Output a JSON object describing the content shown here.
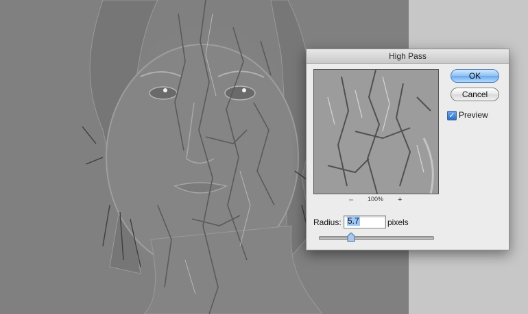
{
  "dialog": {
    "title": "High Pass",
    "ok_label": "OK",
    "cancel_label": "Cancel",
    "preview_label": "Preview",
    "preview_checked": true,
    "zoom_minus": "–",
    "zoom_level": "100%",
    "zoom_plus": "+",
    "radius_label": "Radius:",
    "radius_value": "5.7",
    "radius_unit": "pixels",
    "radius_slider_fraction": 0.28
  },
  "colors": {
    "canvas_gray": "#808080",
    "pasteboard": "#c7c7c7",
    "dialog_bg": "#ececec",
    "ok_blue": "#6aa9ec",
    "selection": "#9ec6f5"
  },
  "icons": [
    "checkmark-icon",
    "slider-thumb-icon",
    "zoom-out-icon",
    "zoom-in-icon"
  ]
}
